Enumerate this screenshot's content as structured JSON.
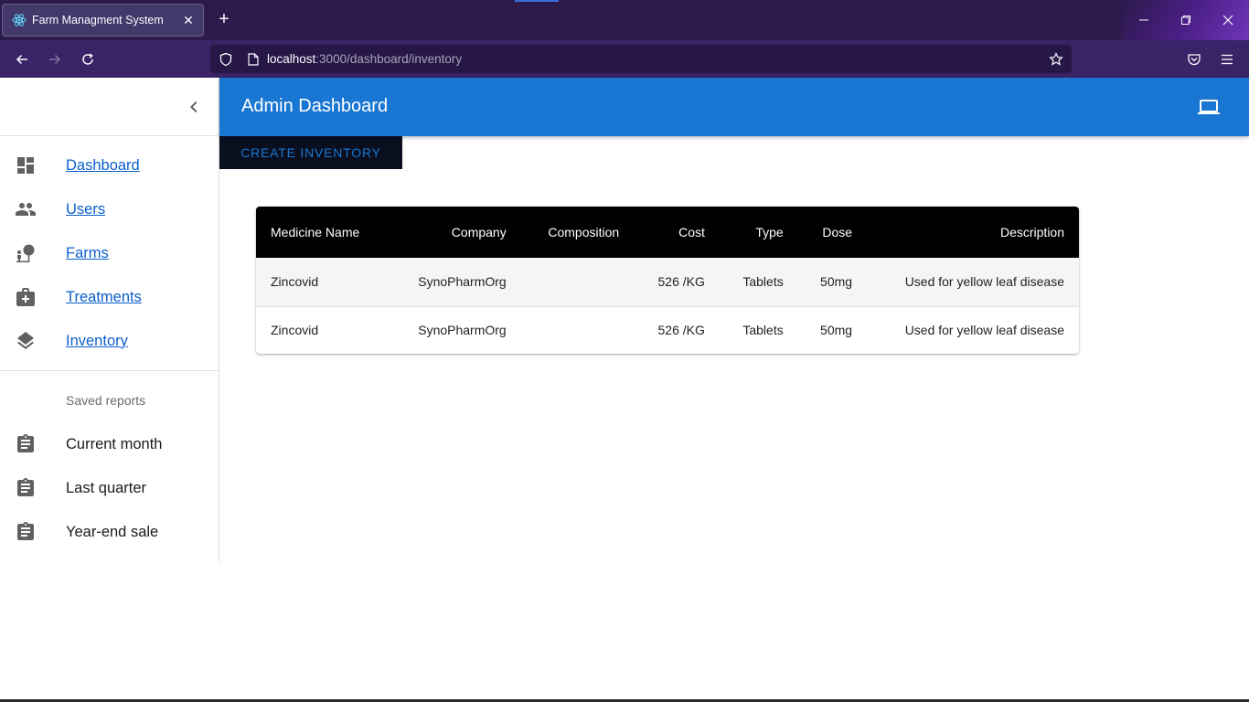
{
  "browser": {
    "tab_title": "Farm Managment System",
    "url_host": "localhost",
    "url_path": ":3000/dashboard/inventory"
  },
  "header": {
    "title": "Admin Dashboard",
    "right_icon": "laptop-icon"
  },
  "sidebar": {
    "nav_items": [
      {
        "label": "Dashboard",
        "icon": "dashboard-icon"
      },
      {
        "label": "Users",
        "icon": "people-icon"
      },
      {
        "label": "Farms",
        "icon": "nature-people-icon"
      },
      {
        "label": "Treatments",
        "icon": "medical-bag-icon"
      },
      {
        "label": "Inventory",
        "icon": "layers-icon"
      }
    ],
    "saved_reports_header": "Saved reports",
    "reports": [
      {
        "label": "Current month",
        "icon": "assignment-icon"
      },
      {
        "label": "Last quarter",
        "icon": "assignment-icon"
      },
      {
        "label": "Year-end sale",
        "icon": "assignment-icon"
      }
    ]
  },
  "actions": {
    "create_label": "CREATE INVENTORY"
  },
  "table": {
    "columns": [
      "Medicine Name",
      "Company",
      "Composition",
      "Cost",
      "Type",
      "Dose",
      "Description"
    ],
    "rows": [
      [
        "Zincovid",
        "SynoPharmOrg",
        "",
        "526 /KG",
        "Tablets",
        "50mg",
        "Used for yellow leaf disease"
      ],
      [
        "Zincovid",
        "SynoPharmOrg",
        "",
        "526 /KG",
        "Tablets",
        "50mg",
        "Used for yellow leaf disease"
      ]
    ]
  },
  "colors": {
    "appbar": "#1976d2",
    "link": "#0b5fcc",
    "table_header": "#000000"
  }
}
